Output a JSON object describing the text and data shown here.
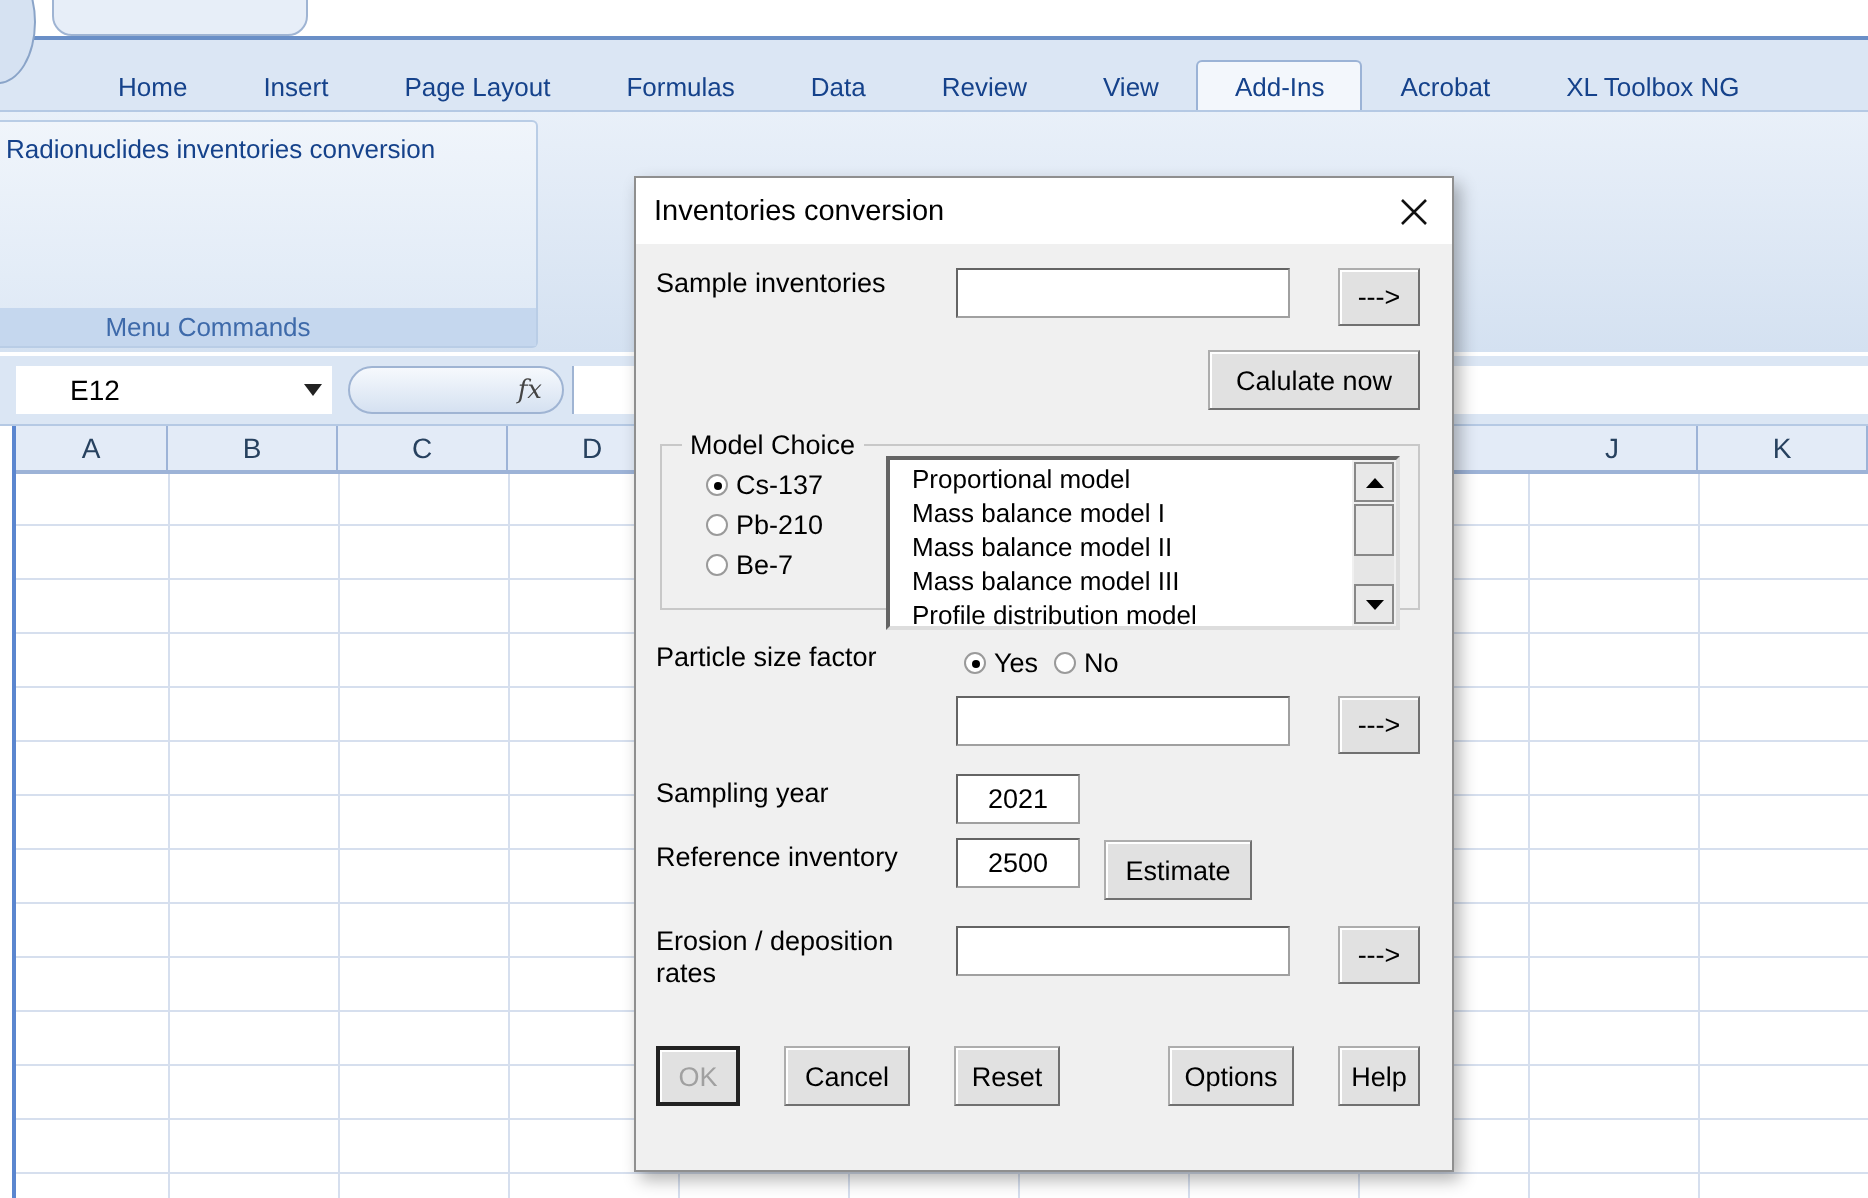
{
  "ribbon": {
    "tabs": [
      {
        "label": "Home",
        "selected": false
      },
      {
        "label": "Insert",
        "selected": false
      },
      {
        "label": "Page Layout",
        "selected": false
      },
      {
        "label": "Formulas",
        "selected": false
      },
      {
        "label": "Data",
        "selected": false
      },
      {
        "label": "Review",
        "selected": false
      },
      {
        "label": "View",
        "selected": false
      },
      {
        "label": "Add-Ins",
        "selected": true
      },
      {
        "label": "Acrobat",
        "selected": false
      },
      {
        "label": "XL Toolbox NG",
        "selected": false
      }
    ],
    "group_button": "Radionuclides inventories conversion",
    "group_label": "Menu Commands"
  },
  "formula_bar": {
    "name_box": "E12",
    "function_symbol": "fx"
  },
  "sheet": {
    "column_headers": [
      "A",
      "B",
      "C",
      "D",
      "J",
      "K"
    ]
  },
  "dialog": {
    "title": "Inventories conversion",
    "sample_inventories": {
      "label": "Sample inventories",
      "button": "--->"
    },
    "calculate_button": "Calulate now",
    "model_choice": {
      "legend": "Model Choice",
      "options": [
        {
          "label": "Cs-137",
          "selected": true
        },
        {
          "label": "Pb-210",
          "selected": false
        },
        {
          "label": "Be-7",
          "selected": false
        }
      ],
      "models": [
        "Proportional model",
        "Mass balance model I",
        "Mass balance model II",
        "Mass balance model III",
        "Profile distribution model"
      ]
    },
    "particle_size": {
      "label": "Particle size factor",
      "options": [
        {
          "label": "Yes",
          "selected": true
        },
        {
          "label": "No",
          "selected": false
        }
      ],
      "button": "--->"
    },
    "sampling_year": {
      "label": "Sampling year",
      "value": "2021"
    },
    "reference_inventory": {
      "label": "Reference inventory",
      "value": "2500",
      "button": "Estimate"
    },
    "erosion_rates": {
      "label": "Erosion / deposition rates",
      "button": "--->"
    },
    "buttons": [
      {
        "label": "OK",
        "disabled": true,
        "default": true
      },
      {
        "label": "Cancel",
        "disabled": false,
        "default": false
      },
      {
        "label": "Reset",
        "disabled": false,
        "default": false
      },
      {
        "label": "Options",
        "disabled": false,
        "default": false
      },
      {
        "label": "Help",
        "disabled": false,
        "default": false
      }
    ]
  }
}
